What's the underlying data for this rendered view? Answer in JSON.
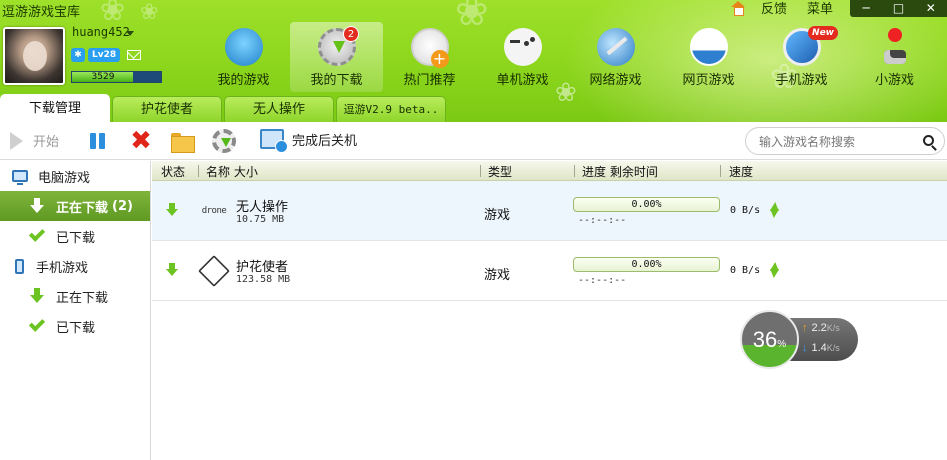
{
  "app": {
    "title": "逗游游戏宝库",
    "top_links": [
      "反馈",
      "菜单"
    ],
    "window_controls": [
      "─",
      "□",
      "✕"
    ]
  },
  "user": {
    "name": "huang452",
    "level": "Lv28",
    "exp_value": "3529",
    "exp_fraction": 0.68
  },
  "nav": {
    "items": [
      {
        "label": "我的游戏",
        "icon": "controller-user-icon"
      },
      {
        "label": "我的下载",
        "icon": "download-gear-icon",
        "badge": "2",
        "active": true
      },
      {
        "label": "热门推荐",
        "icon": "hot-recommend-icon"
      },
      {
        "label": "单机游戏",
        "icon": "gamepad-icon"
      },
      {
        "label": "网络游戏",
        "icon": "globe-sword-icon"
      },
      {
        "label": "网页游戏",
        "icon": "web-page-icon"
      },
      {
        "label": "手机游戏",
        "icon": "mobile-icon",
        "badge_new": "New"
      },
      {
        "label": "小游戏",
        "icon": "joystick-icon"
      }
    ]
  },
  "tabs": [
    "下载管理",
    "护花使者",
    "无人操作",
    "逗游V2.9 beta.."
  ],
  "toolbar": {
    "start_label": "开始",
    "shutdown_label": "完成后关机",
    "search_placeholder": "输入游戏名称搜索"
  },
  "sidebar": {
    "pc_category": "电脑游戏",
    "pc_downloading": "正在下载",
    "pc_downloading_count": "(2)",
    "pc_downloaded": "已下载",
    "mobile_category": "手机游戏",
    "mobile_downloading": "正在下载",
    "mobile_downloaded": "已下载"
  },
  "table": {
    "headers": {
      "status": "状态",
      "name_size": "名称 大小",
      "type": "类型",
      "progress_eta": "进度 剩余时间",
      "speed": "速度"
    },
    "rows": [
      {
        "name": "无人操作",
        "size": "10.75 MB",
        "type": "游戏",
        "progress": "0.00%",
        "progress_fraction": 0,
        "eta": "--:--:--",
        "speed": "0 B/s",
        "logo_text": "drone"
      },
      {
        "name": "护花使者",
        "size": "123.58 MB",
        "type": "游戏",
        "progress": "0.00%",
        "progress_fraction": 0,
        "eta": "--:--:--",
        "speed": "0 B/s",
        "logo_text": ""
      }
    ]
  },
  "speed_widget": {
    "percent": "36",
    "percent_sign": "%",
    "upload": "2.2",
    "download": "1.4",
    "unit": "K/s"
  },
  "colors": {
    "banner_green": "#8fd81e",
    "selected_green": "#6fa82e",
    "progress_green": "#7cc31e",
    "badge_red": "#e42b1f"
  }
}
